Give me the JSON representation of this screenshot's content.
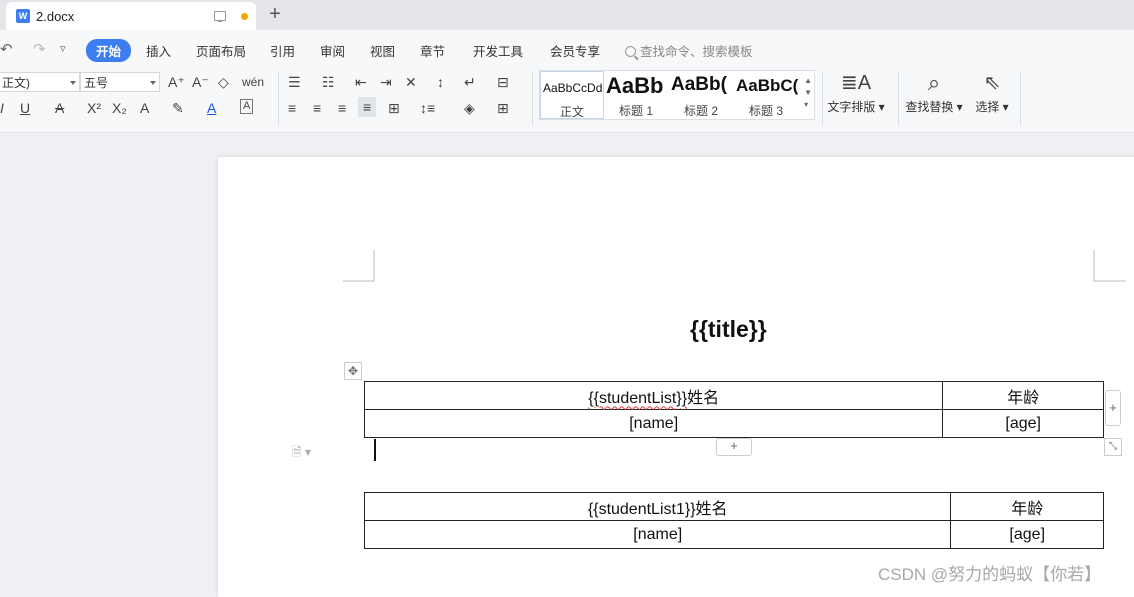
{
  "tab": {
    "title": "2.docx"
  },
  "menu": {
    "items": [
      "开始",
      "插入",
      "页面布局",
      "引用",
      "审阅",
      "视图",
      "章节",
      "开发工具",
      "会员专享"
    ],
    "search_placeholder": "查找命令、搜索模板"
  },
  "toolbar": {
    "font_name": "正文)",
    "font_size": "五号",
    "styles": [
      {
        "sample": "AaBbCcDd",
        "name": "正文"
      },
      {
        "sample": "AaBb",
        "name": "标题 1"
      },
      {
        "sample": "AaBb(",
        "name": "标题 2"
      },
      {
        "sample": "AaBbC(",
        "name": "标题 3"
      }
    ],
    "text_layout_label": "文字排版",
    "find_replace_label": "查找替换",
    "select_label": "选择"
  },
  "document": {
    "title": "{{title}}",
    "table1": {
      "header_tpl": "{{studentList}}",
      "header_name": "姓名",
      "header_age": "年龄",
      "row_name": "[name]",
      "row_age": "[age]"
    },
    "table2": {
      "header_tpl": "{{studentList1}}",
      "header_name": "姓名",
      "header_age": "年龄",
      "row_name": "[name]",
      "row_age": "[age]"
    }
  },
  "watermark": "CSDN @努力的蚂蚁【你若】"
}
